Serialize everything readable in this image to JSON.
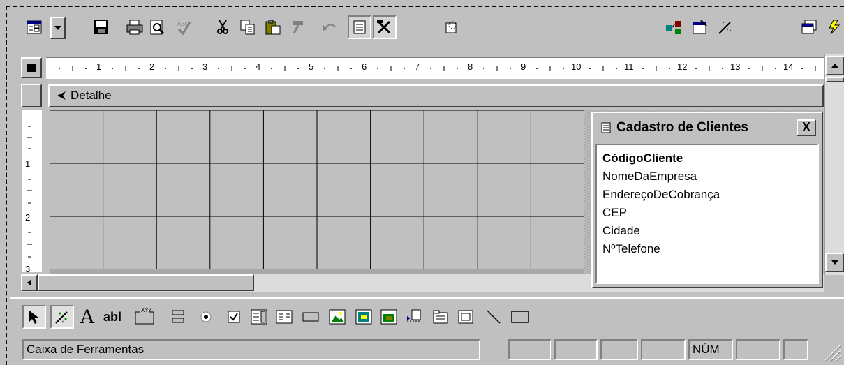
{
  "section": {
    "label": "Detalhe"
  },
  "ruler": {
    "numbers": [
      "1",
      "2",
      "3",
      "4",
      "5",
      "6",
      "7",
      "8",
      "9",
      "10",
      "11",
      "12",
      "13",
      "14"
    ]
  },
  "vruler": {
    "numbers": [
      "1",
      "2",
      "3"
    ]
  },
  "field_list": {
    "title": "Cadastro de Clientes",
    "close_label": "X",
    "fields": [
      "CódigoCliente",
      "NomeDaEmpresa",
      "EndereçoDeCobrança",
      "CEP",
      "Cidade",
      "NºTelefone"
    ]
  },
  "toolbox": {
    "label_tool": "A",
    "textbox_tool": "abl",
    "option_group_tool": "XYZ"
  },
  "status": {
    "text": "Caixa de Ferramentas",
    "num_indicator": "NÚM"
  },
  "colors": {
    "title_bar": "#c0c0c0",
    "face": "#c0c0c0",
    "white": "#ffffff"
  }
}
